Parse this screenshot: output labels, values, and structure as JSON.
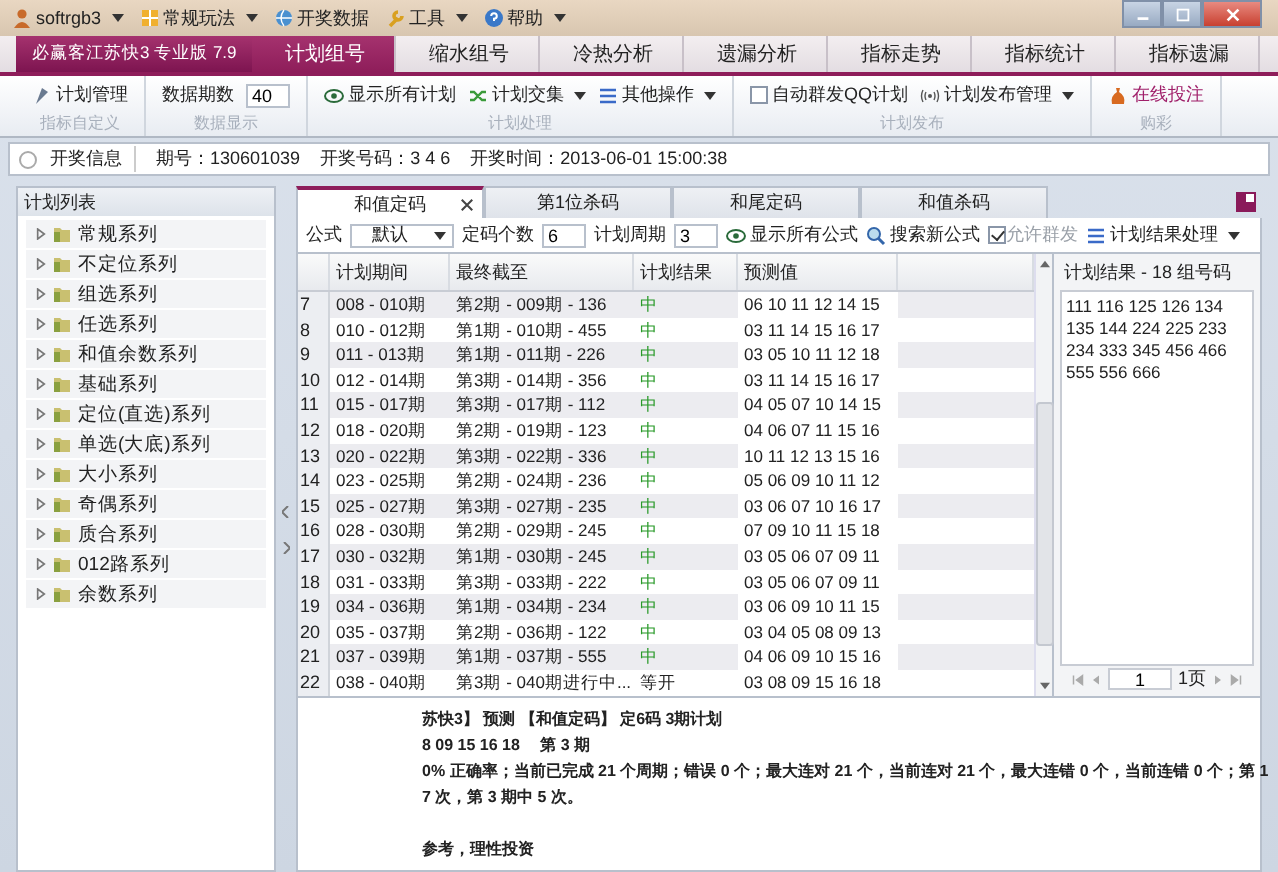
{
  "quick_access": [
    {
      "label": "softrgb3",
      "menu": true
    },
    {
      "label": "常规玩法",
      "menu": true
    },
    {
      "label": "开奖数据",
      "menu": false
    },
    {
      "label": "工具",
      "menu": true
    },
    {
      "label": "帮助",
      "menu": true
    }
  ],
  "ribbon": {
    "app_button": "必赢客江苏快3 专业版 7.9",
    "tabs": [
      {
        "label": "计划组号",
        "selected": true
      },
      {
        "label": "缩水组号",
        "selected": false
      },
      {
        "label": "冷热分析",
        "selected": false
      },
      {
        "label": "遗漏分析",
        "selected": false
      },
      {
        "label": "指标走势",
        "selected": false
      },
      {
        "label": "指标统计",
        "selected": false
      },
      {
        "label": "指标遗漏",
        "selected": false
      }
    ],
    "groups": [
      {
        "label": "指标自定义",
        "items": [
          {
            "kind": "button",
            "label": "计划管理",
            "menu": false
          }
        ]
      },
      {
        "label": "数据显示",
        "items": [
          {
            "kind": "field",
            "label": "数据期数",
            "value": "40"
          }
        ]
      },
      {
        "label": "计划处理",
        "items": [
          {
            "kind": "button",
            "label": "显示所有计划",
            "menu": false
          },
          {
            "kind": "button",
            "label": "计划交集",
            "menu": true
          },
          {
            "kind": "button",
            "label": "其他操作",
            "menu": true
          }
        ]
      },
      {
        "label": "计划发布",
        "items": [
          {
            "kind": "checkbox",
            "label": "自动群发QQ计划",
            "checked": false
          },
          {
            "kind": "button",
            "label": "计划发布管理",
            "menu": true
          }
        ]
      },
      {
        "label": "购彩",
        "items": [
          {
            "kind": "button",
            "label": "在线投注",
            "menu": false
          }
        ]
      }
    ]
  },
  "info_bar": {
    "button": "开奖信息",
    "fields": [
      "期号：130601039",
      "开奖号码：3 4 6",
      "开奖时间：2013-06-01 15:00:38"
    ]
  },
  "sidebar": {
    "title": "计划列表",
    "items": [
      {
        "label": "常规系列",
        "expanded": false
      },
      {
        "label": "不定位系列",
        "expanded": false
      },
      {
        "label": "组选系列",
        "expanded": false
      },
      {
        "label": "任选系列",
        "expanded": false
      },
      {
        "label": "和值余数系列",
        "expanded": false
      },
      {
        "label": "基础系列",
        "expanded": false
      },
      {
        "label": "定位(直选)系列",
        "expanded": false
      },
      {
        "label": "单选(大底)系列",
        "expanded": false
      },
      {
        "label": "大小系列",
        "expanded": false
      },
      {
        "label": "奇偶系列",
        "expanded": false
      },
      {
        "label": "质合系列",
        "expanded": false
      },
      {
        "label": "012路系列",
        "expanded": false
      },
      {
        "label": "余数系列",
        "expanded": false
      }
    ]
  },
  "doc_tabs": [
    {
      "label": "和值定码",
      "selected": true,
      "closable": true
    },
    {
      "label": "第1位杀码",
      "selected": false,
      "closable": false
    },
    {
      "label": "和尾定码",
      "selected": false,
      "closable": false
    },
    {
      "label": "和值杀码",
      "selected": false,
      "closable": false
    }
  ],
  "toolbar": {
    "formula_label": "公式",
    "formula_value": "默认",
    "count_label": "定码个数",
    "count_value": "6",
    "cycle_label": "计划周期",
    "cycle_value": "3",
    "show_all": "显示所有公式",
    "search": "搜索新公式",
    "allow_group": {
      "label": "允许群发",
      "checked": true,
      "disabled": true
    },
    "result_menu": "计划结果处理"
  },
  "table": {
    "columns": [
      "计划期间",
      "最终截至",
      "计划结果",
      "预测值"
    ],
    "rows": [
      {
        "num": "7",
        "period": "008 - 010期",
        "last": "第2期 - 009期 - 136",
        "result": "中",
        "hit": true,
        "prediction": "06 10 11 12 14 15"
      },
      {
        "num": "8",
        "period": "010 - 012期",
        "last": "第1期 - 010期 - 455",
        "result": "中",
        "hit": true,
        "prediction": "03 11 14 15 16 17"
      },
      {
        "num": "9",
        "period": "011 - 013期",
        "last": "第1期 - 011期 - 226",
        "result": "中",
        "hit": true,
        "prediction": "03 05 10 11 12 18"
      },
      {
        "num": "10",
        "period": "012 - 014期",
        "last": "第3期 - 014期 - 356",
        "result": "中",
        "hit": true,
        "prediction": "03 11 14 15 16 17"
      },
      {
        "num": "11",
        "period": "015 - 017期",
        "last": "第3期 - 017期 - 112",
        "result": "中",
        "hit": true,
        "prediction": "04 05 07 10 14 15"
      },
      {
        "num": "12",
        "period": "018 - 020期",
        "last": "第2期 - 019期 - 123",
        "result": "中",
        "hit": true,
        "prediction": "04 06 07 11 15 16"
      },
      {
        "num": "13",
        "period": "020 - 022期",
        "last": "第3期 - 022期 - 336",
        "result": "中",
        "hit": true,
        "prediction": "10 11 12 13 15 16"
      },
      {
        "num": "14",
        "period": "023 - 025期",
        "last": "第2期 - 024期 - 236",
        "result": "中",
        "hit": true,
        "prediction": "05 06 09 10 11 12"
      },
      {
        "num": "15",
        "period": "025 - 027期",
        "last": "第3期 - 027期 - 235",
        "result": "中",
        "hit": true,
        "prediction": "03 06 07 10 16 17"
      },
      {
        "num": "16",
        "period": "028 - 030期",
        "last": "第2期 - 029期 - 245",
        "result": "中",
        "hit": true,
        "prediction": "07 09 10 11 15 18"
      },
      {
        "num": "17",
        "period": "030 - 032期",
        "last": "第1期 - 030期 - 245",
        "result": "中",
        "hit": true,
        "prediction": "03 05 06 07 09 11"
      },
      {
        "num": "18",
        "period": "031 - 033期",
        "last": "第3期 - 033期 - 222",
        "result": "中",
        "hit": true,
        "prediction": "03 05 06 07 09 11"
      },
      {
        "num": "19",
        "period": "034 - 036期",
        "last": "第1期 - 034期 - 234",
        "result": "中",
        "hit": true,
        "prediction": "03 06 09 10 11 15"
      },
      {
        "num": "20",
        "period": "035 - 037期",
        "last": "第2期 - 036期 - 122",
        "result": "中",
        "hit": true,
        "prediction": "03 04 05 08 09 13"
      },
      {
        "num": "21",
        "period": "037 - 039期",
        "last": "第1期 - 037期 - 555",
        "result": "中",
        "hit": true,
        "prediction": "04 06 09 10 15 16"
      },
      {
        "num": "22",
        "period": "038 - 040期",
        "last": "第3期 - 040期进行中...",
        "result": "等开",
        "hit": false,
        "prediction": "03 08 09 15 16 18"
      }
    ]
  },
  "result_panel": {
    "title": "计划结果 - 18 组号码",
    "numbers": "111 116 125 126 134 135 144 224 225 233 234 333 345 456 466 555 556 666",
    "page": "1",
    "page_total": "1页"
  },
  "report": [
    "苏快3】 预测 【和值定码】 定6码 3期计划",
    "8 09 15 16 18　 第 3 期",
    "0% 正确率；当前已完成 21 个周期；错误 0 个；最大连对 21 个，当前连对 21 个，最大连错 0 个，当前连错 0 个；第 1",
    "7 次，第 3 期中 5 次。",
    "参考，理性投资"
  ]
}
